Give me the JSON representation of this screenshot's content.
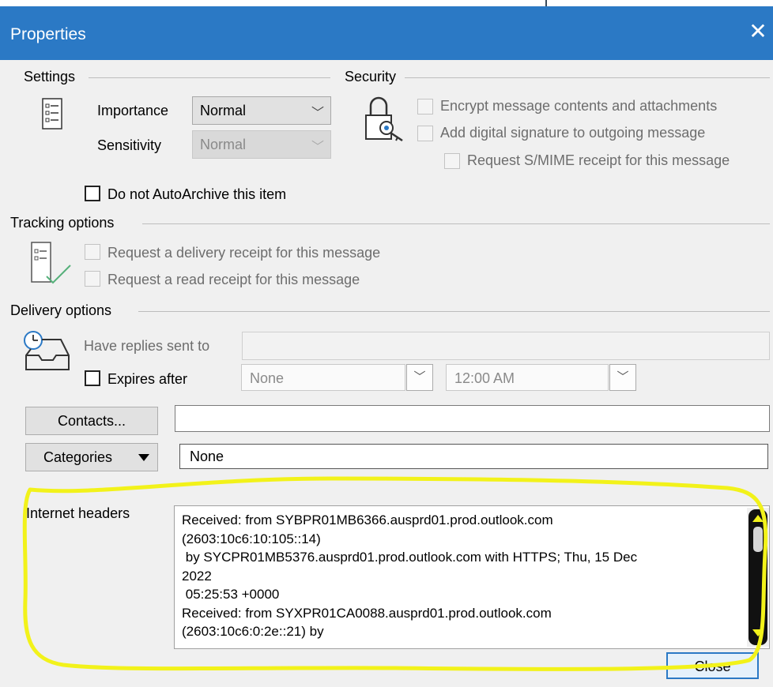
{
  "window": {
    "title": "Properties",
    "close_glyph": "✕"
  },
  "settings": {
    "label": "Settings",
    "importance_label": "Importance",
    "importance_value": "Normal",
    "sensitivity_label": "Sensitivity",
    "sensitivity_value": "Normal",
    "autoarchive_label": "Do not AutoArchive this item"
  },
  "security": {
    "label": "Security",
    "encrypt_label": "Encrypt message contents and attachments",
    "signature_label": "Add digital signature to outgoing message",
    "smime_label": "Request S/MIME receipt for this message"
  },
  "tracking": {
    "label": "Tracking options",
    "delivery_receipt_label": "Request a delivery receipt for this message",
    "read_receipt_label": "Request a read receipt for this message"
  },
  "delivery": {
    "label": "Delivery options",
    "replies_label": "Have replies sent to",
    "replies_value": "",
    "expires_label": "Expires after",
    "expires_date": "None",
    "expires_time": "12:00 AM"
  },
  "contacts": {
    "button_label": "Contacts...",
    "value": ""
  },
  "categories": {
    "button_label": "Categories",
    "value": "None"
  },
  "internet_headers": {
    "label": "Internet headers",
    "text": "Received: from SYBPR01MB6366.ausprd01.prod.outlook.com\n(2603:10c6:10:105::14)\n by SYCPR01MB5376.ausprd01.prod.outlook.com with HTTPS; Thu, 15 Dec\n2022\n 05:25:53 +0000\nReceived: from SYXPR01CA0088.ausprd01.prod.outlook.com\n(2603:10c6:0:2e::21) by"
  },
  "footer": {
    "close_label": "Close"
  },
  "colors": {
    "titlebar": "#2b79c5",
    "highlight": "#f2f21a",
    "dialog_bg": "#f0f0f0"
  },
  "icons": [
    "settings-list-icon",
    "padlock-key-icon",
    "tracking-checklist-icon",
    "clock-tray-icon",
    "chevron-down-icon",
    "scroll-up-icon",
    "scroll-down-icon"
  ]
}
